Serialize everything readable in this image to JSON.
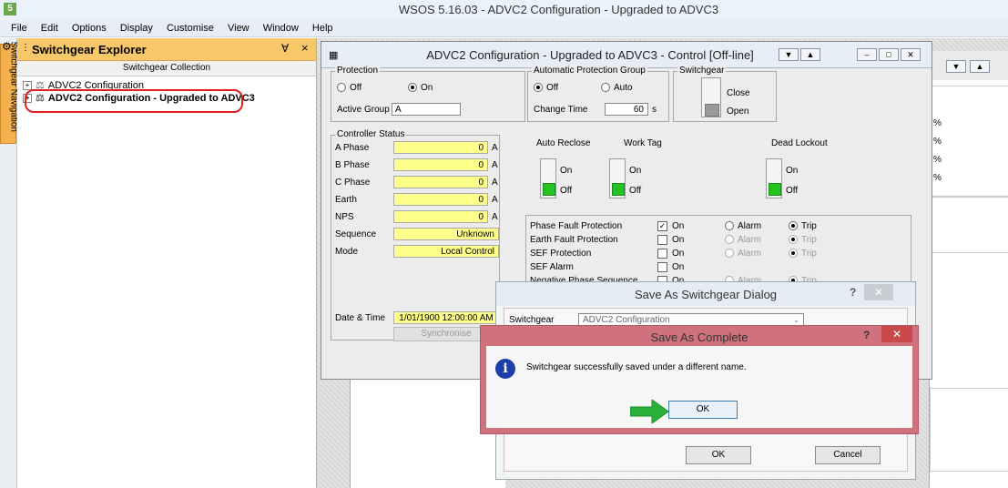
{
  "app": {
    "title": "WSOS 5.16.03 - ADVC2 Configuration - Upgraded to ADVC3",
    "icon_letter": "5"
  },
  "menu": [
    "File",
    "Edit",
    "Options",
    "Display",
    "Customise",
    "View",
    "Window",
    "Help"
  ],
  "side_tab": {
    "label": "Switchgear Navigation"
  },
  "explorer": {
    "title": "Switchgear Explorer",
    "pin": "ᴜ",
    "close": "×",
    "collection_header": "Switchgear Collection",
    "items": [
      {
        "label": "ADVC2 Configuration",
        "bold": false
      },
      {
        "label": "ADVC2 Configuration - Upgraded to ADVC3",
        "bold": true
      }
    ]
  },
  "right_window": {
    "pct_values": [
      "%",
      "%",
      "%",
      "%"
    ]
  },
  "control": {
    "title": "ADVC2 Configuration - Upgraded to ADVC3 - Control [Off-line]",
    "protection": {
      "label": "Protection",
      "off": "Off",
      "on": "On",
      "active_group_label": "Active Group",
      "active_group_value": "A"
    },
    "apg": {
      "label": "Automatic Protection Group",
      "off": "Off",
      "auto": "Auto",
      "change_time_label": "Change Time",
      "change_time_value": "60",
      "change_time_unit": "s"
    },
    "switchgear": {
      "label": "Switchgear",
      "close": "Close",
      "open": "Open"
    },
    "controller_status": {
      "label": "Controller Status",
      "rows": [
        {
          "label": "A Phase",
          "value": "0",
          "unit": "A"
        },
        {
          "label": "B Phase",
          "value": "0",
          "unit": "A"
        },
        {
          "label": "C Phase",
          "value": "0",
          "unit": "A"
        },
        {
          "label": "Earth",
          "value": "0",
          "unit": "A"
        },
        {
          "label": "NPS",
          "value": "0",
          "unit": "A"
        }
      ],
      "sequence_label": "Sequence",
      "sequence_value": "Unknown",
      "mode_label": "Mode",
      "mode_value": "Local Control",
      "datetime_label": "Date & Time",
      "datetime_value": "1/01/1900 12:00:00 AM",
      "synchronise": "Synchronise"
    },
    "toggles": [
      {
        "label": "Auto Reclose",
        "on": "On",
        "off": "Off"
      },
      {
        "label": "Work Tag",
        "on": "On",
        "off": "Off"
      },
      {
        "label": "Dead Lockout",
        "on": "On",
        "off": "Off"
      }
    ],
    "protection_table": [
      {
        "label": "Phase Fault Protection",
        "on": "On",
        "alarm": "Alarm",
        "trip": "Trip"
      },
      {
        "label": "Earth Fault Protection",
        "on": "On",
        "alarm": "Alarm",
        "trip": "Trip"
      },
      {
        "label": "SEF Protection",
        "on": "On",
        "alarm": "Alarm",
        "trip": "Trip"
      },
      {
        "label": "SEF Alarm",
        "on": "On"
      },
      {
        "label": "Negative Phase Sequence",
        "on": "On",
        "alarm": "Alarm",
        "trip": "Trip"
      }
    ]
  },
  "save_as": {
    "title": "Save As Switchgear Dialog",
    "help": "?",
    "close": "✕",
    "switchgear_label": "Switchgear",
    "switchgear_value": "ADVC2 Configuration",
    "ok": "OK",
    "cancel": "Cancel"
  },
  "complete": {
    "title": "Save As Complete",
    "help": "?",
    "close": "✕",
    "info_glyph": "i",
    "message": "Switchgear successfully saved under a different name.",
    "ok": "OK"
  },
  "colors": {
    "highlight_oval": "#e02020",
    "arrow": "#2bb03a",
    "led_green": "#22c322",
    "yellow_field": "#ffff8c"
  }
}
